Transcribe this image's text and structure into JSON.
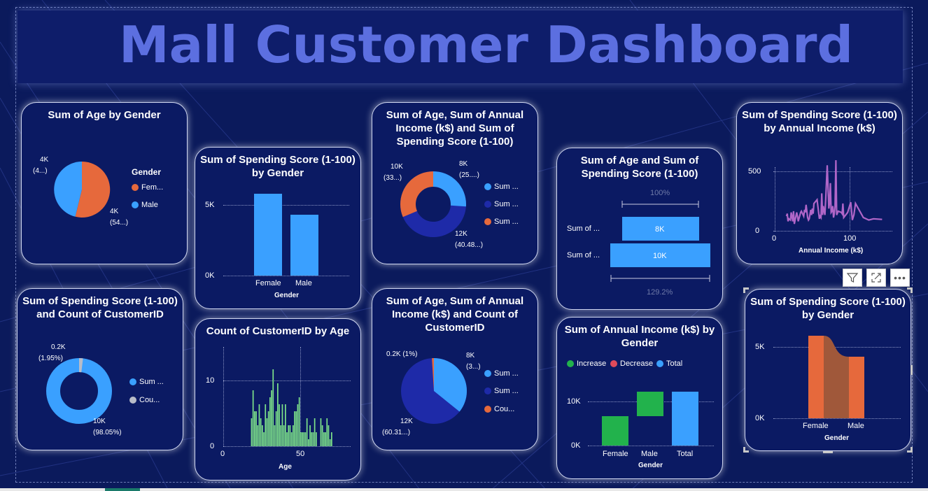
{
  "title": "Mall Customer Dashboard",
  "colors": {
    "background": "#0b1a5c",
    "light_blue": "#3aa0ff",
    "orange": "#e6693c",
    "dark_blue": "#1e2aa8",
    "green": "#22b24c",
    "purple": "#b066c8",
    "mint": "#7de28a"
  },
  "card1": {
    "title": "Sum of Age by Gender",
    "legend_title": "Gender",
    "legend": [
      "Fem...",
      "Male"
    ],
    "label_top": "4K",
    "label_top2": "(4...)",
    "label_bottom": "4K",
    "label_bottom2": "(54...)",
    "chart_data": {
      "type": "pie",
      "categories": [
        "Female",
        "Male"
      ],
      "values": [
        54,
        46
      ]
    }
  },
  "card2": {
    "title": "Sum of Spending Score (1-100) by Gender",
    "y_ticks": [
      "5K",
      "0K"
    ],
    "categories": [
      "Female",
      "Male"
    ],
    "xlabel": "Gender",
    "chart_data": {
      "type": "bar",
      "categories": [
        "Female",
        "Male"
      ],
      "values": [
        5800,
        4300
      ],
      "xlabel": "Gender",
      "ylim": [
        0,
        5800
      ]
    }
  },
  "card3": {
    "title": "Sum of Age, Sum of Annual Income (k$) and Sum of Spending Score (1-100)",
    "label_a": "10K",
    "label_a2": "(33...)",
    "label_b": "8K",
    "label_b2": "(25....)",
    "label_c": "12K",
    "label_c2": "(40.48...)",
    "legend": [
      "Sum ...",
      "Sum ...",
      "Sum ..."
    ],
    "chart_data": {
      "type": "pie",
      "categories": [
        "Sum of Age",
        "Sum of Annual Income (k$)",
        "Sum of Spending Score (1-100)"
      ],
      "values": [
        7900,
        12100,
        10100
      ]
    }
  },
  "card4": {
    "title": "Sum of Age and Sum of Spending Score (1-100)",
    "top_pct": "100%",
    "bottom_pct": "129.2%",
    "rows": [
      {
        "label": "Sum of ...",
        "value": "8K"
      },
      {
        "label": "Sum of ...",
        "value": "10K"
      }
    ],
    "chart_data": {
      "type": "bar",
      "categories": [
        "Sum of Age",
        "Sum of Spending Score (1-100)"
      ],
      "values": [
        7800,
        10100
      ]
    }
  },
  "card5": {
    "title": "Sum of Spending Score (1-100) by Annual Income (k$)",
    "y_ticks": [
      "500",
      "0"
    ],
    "x_ticks": [
      "0",
      "100"
    ],
    "xlabel": "Annual Income (k$)",
    "chart_data": {
      "type": "line",
      "x": [
        15,
        16,
        17,
        18,
        19,
        20,
        21,
        23,
        24,
        25,
        28,
        29,
        30,
        33,
        34,
        37,
        38,
        39,
        40,
        42,
        43,
        44,
        46,
        47,
        48,
        49,
        50,
        54,
        57,
        58,
        59,
        60,
        61,
        62,
        63,
        64,
        65,
        67,
        69,
        70,
        71,
        72,
        73,
        74,
        75,
        76,
        77,
        78,
        79,
        81,
        85,
        86,
        87,
        88,
        93,
        97,
        98,
        99,
        101,
        103,
        113,
        120,
        126,
        137
      ],
      "y": [
        120,
        140,
        80,
        100,
        95,
        90,
        150,
        80,
        160,
        60,
        150,
        120,
        80,
        150,
        160,
        120,
        170,
        150,
        210,
        110,
        90,
        100,
        170,
        130,
        180,
        140,
        220,
        250,
        100,
        120,
        110,
        300,
        130,
        200,
        160,
        130,
        250,
        520,
        180,
        230,
        380,
        150,
        160,
        200,
        110,
        140,
        200,
        560,
        130,
        160,
        150,
        140,
        220,
        110,
        150,
        230,
        160,
        90,
        130,
        220,
        110,
        90,
        100,
        95
      ],
      "xlabel": "Annual Income (k$)",
      "ylim": [
        0,
        560
      ],
      "xlim": [
        0,
        140
      ]
    }
  },
  "card6": {
    "title": "Sum of Spending Score (1-100) and Count of CustomerID",
    "label_a": "0.2K",
    "label_a2": "(1.95%)",
    "label_b": "10K",
    "label_b2": "(98.05%)",
    "legend": [
      "Sum ...",
      "Cou..."
    ],
    "chart_data": {
      "type": "pie",
      "categories": [
        "Sum of Spending Score (1-100)",
        "Count of CustomerID"
      ],
      "values": [
        10040,
        200
      ]
    }
  },
  "card7": {
    "title": "Count of CustomerID by Age",
    "y_ticks": [
      "10",
      "0"
    ],
    "x_ticks": [
      "0",
      "50"
    ],
    "xlabel": "Age",
    "chart_data": {
      "type": "bar",
      "x": [
        18,
        19,
        20,
        21,
        22,
        23,
        24,
        25,
        26,
        27,
        28,
        29,
        30,
        31,
        32,
        33,
        34,
        35,
        36,
        37,
        38,
        39,
        40,
        41,
        42,
        43,
        44,
        45,
        46,
        47,
        48,
        49,
        50,
        51,
        52,
        53,
        54,
        55,
        56,
        57,
        58,
        59,
        60,
        63,
        64,
        65,
        66,
        67,
        68,
        69,
        70
      ],
      "values": [
        4,
        8,
        5,
        5,
        3,
        6,
        4,
        3,
        2,
        6,
        4,
        5,
        7,
        8,
        11,
        3,
        5,
        9,
        6,
        3,
        6,
        3,
        6,
        2,
        3,
        3,
        2,
        3,
        5,
        5,
        6,
        7,
        2,
        2,
        2,
        2,
        4,
        1,
        3,
        2,
        2,
        4,
        2,
        4,
        3,
        2,
        2,
        4,
        3,
        1,
        2
      ],
      "xlabel": "Age",
      "ylim": [
        0,
        11
      ]
    }
  },
  "card8": {
    "title": "Sum of Age, Sum of Annual Income (k$) and Count of CustomerID",
    "label_a": "0.2K (1%)",
    "label_b": "8K",
    "label_b2": "(3...)",
    "label_c": "12K",
    "label_c2": "(60.31...)",
    "legend": [
      "Sum ...",
      "Sum ...",
      "Cou..."
    ],
    "chart_data": {
      "type": "pie",
      "categories": [
        "Sum of Age",
        "Sum of Annual Income (k$)",
        "Count of CustomerID"
      ],
      "values": [
        7790,
        12080,
        200
      ]
    }
  },
  "card9": {
    "title": "Sum of Annual Income (k$) by Gender",
    "legend": [
      "Increase",
      "Decrease",
      "Total"
    ],
    "y_ticks": [
      "10K",
      "0K"
    ],
    "categories": [
      "Female",
      "Male",
      "Total"
    ],
    "xlabel": "Gender",
    "chart_data": {
      "type": "bar",
      "categories": [
        "Female",
        "Male",
        "Total"
      ],
      "values": [
        6640,
        5470,
        12110
      ],
      "xlabel": "Gender",
      "ylim": [
        0,
        12110
      ]
    }
  },
  "card10": {
    "title": "Sum of Spending Score (1-100) by Gender",
    "y_ticks": [
      "5K",
      "0K"
    ],
    "categories": [
      "Female",
      "Male"
    ],
    "xlabel": "Gender",
    "chart_data": {
      "type": "bar",
      "categories": [
        "Female",
        "Male"
      ],
      "values": [
        5770,
        4270
      ],
      "xlabel": "Gender",
      "ylim": [
        0,
        5770
      ]
    }
  },
  "toolbar": {
    "filter_icon": "filter-icon",
    "focus_icon": "focus-mode-icon",
    "more_icon": "more-options-icon"
  }
}
